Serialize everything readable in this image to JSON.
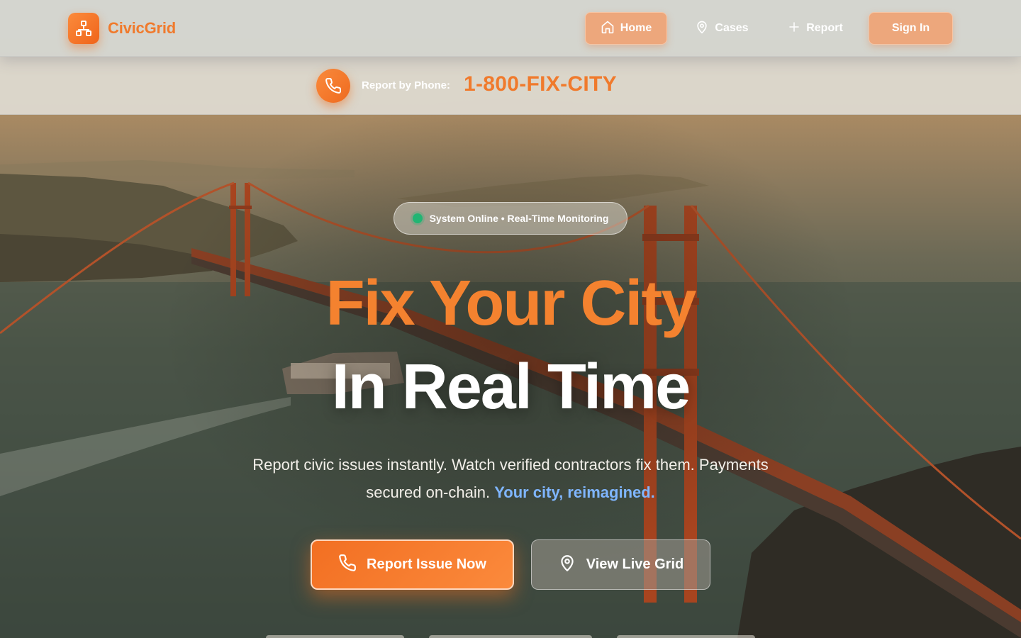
{
  "brand": {
    "name": "CivicGrid",
    "logo_icon": "network-nodes-icon"
  },
  "nav": {
    "items": [
      {
        "label": "Home",
        "icon": "home-icon",
        "active": true
      },
      {
        "label": "Cases",
        "icon": "map-pin-icon",
        "active": false
      },
      {
        "label": "Report",
        "icon": "plus-icon",
        "active": false
      }
    ],
    "sign_in_label": "Sign In"
  },
  "phone_banner": {
    "icon": "phone-icon",
    "label": "Report by Phone:",
    "number": "1-800-FIX-CITY"
  },
  "hero": {
    "status": "System Online • Real-Time Monitoring",
    "status_color": "#22b573",
    "headline_line1": "Fix Your City",
    "headline_line2": "In Real Time",
    "subtitle": "Report civic issues instantly. Watch verified contractors fix them. Payments secured on-chain.",
    "subtitle_accent": "Your city, reimagined.",
    "primary_button": {
      "label": "Report Issue Now",
      "icon": "phone-icon"
    },
    "secondary_button": {
      "label": "View Live Grid",
      "icon": "map-pin-icon"
    }
  },
  "colors": {
    "accent": "#f4822f",
    "nav_active": "#eda77c",
    "link_accent": "#7fb6ff"
  }
}
